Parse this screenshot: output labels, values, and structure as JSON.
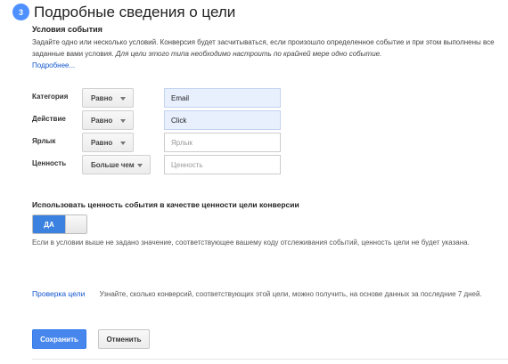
{
  "step": {
    "number": "3",
    "title": "Подробные сведения о цели"
  },
  "conditions": {
    "title": "Условия события",
    "description": "Задайте одно или несколько условий. Конверсия будет засчитываться, если произошло определенное событие и при этом выполнены все заданные вами условия.",
    "description_italic": "Для цели этого типа необходимо настроить по крайней мере одно событие.",
    "more_link": "Подробнее..."
  },
  "fields": [
    {
      "label": "Категория",
      "operator": "Равно",
      "value": "Email",
      "placeholder": "Категория"
    },
    {
      "label": "Действие",
      "operator": "Равно",
      "value": "Click",
      "placeholder": "Действие"
    },
    {
      "label": "Ярлык",
      "operator": "Равно",
      "value": "",
      "placeholder": "Ярлык"
    },
    {
      "label": "Ценность",
      "operator": "Больше чем",
      "value": "",
      "placeholder": "Ценность"
    }
  ],
  "use_value": {
    "title": "Использовать ценность события в качестве ценности цели конверсии",
    "toggle_label": "ДА",
    "toggle_state": "on",
    "help": "Если в условии выше не задано значение, соответствующее вашему коду отслеживания событий, ценность цели не будет указана."
  },
  "verify": {
    "link": "Проверка цели",
    "text": "Узнайте, сколько конверсий, соответствующих этой цели, можно получить, на основе данных за последние 7 дней."
  },
  "buttons": {
    "save": "Сохранить",
    "cancel": "Отменить"
  },
  "colors": {
    "accent": "#4787ed",
    "link": "#1155cc",
    "filled_input": "#e8f0fe"
  }
}
